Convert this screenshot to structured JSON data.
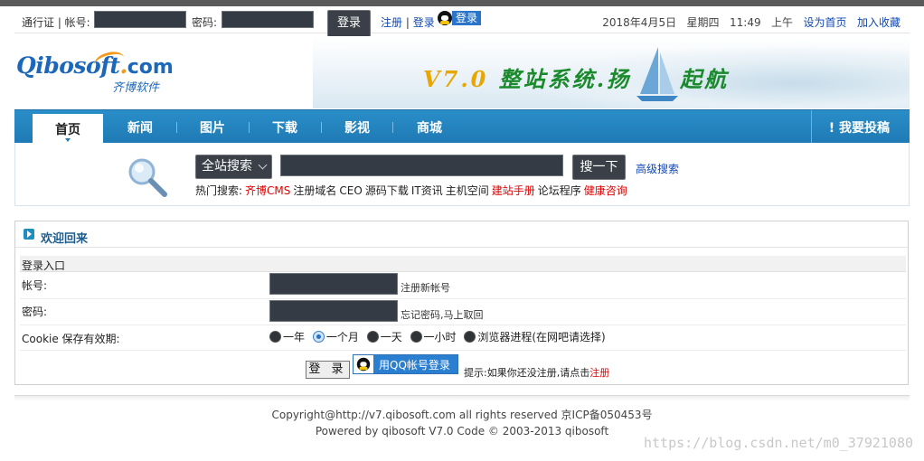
{
  "topbar": {
    "passport_label": "通行证 | 帐号:",
    "password_label": "密码:",
    "login_button": "登录",
    "register_link": "注册",
    "sep": "|",
    "login_link": "登录",
    "qq_login_label": "登录",
    "date": "2018年4月5日",
    "weekday": "星期四",
    "time": "11:49",
    "ampm": "上午",
    "set_homepage": "设为首页",
    "add_favorite": "加入收藏"
  },
  "banner": {
    "logo_main": "Qibosoft",
    "logo_dot": ".",
    "logo_com": "com",
    "logo_cn": "齐博软件",
    "slogan_version": "V7.0",
    "slogan_text1": "整站系统.扬",
    "slogan_text2": "起航"
  },
  "nav": {
    "items": [
      {
        "label": "首页",
        "active": true
      },
      {
        "label": "新闻"
      },
      {
        "label": "图片"
      },
      {
        "label": "下载"
      },
      {
        "label": "影视"
      },
      {
        "label": "商城"
      }
    ],
    "contribute": "我要投稿"
  },
  "search": {
    "scope": "全站搜索",
    "button": "搜一下",
    "advanced": "高级搜索",
    "hot_label": "热门搜索:",
    "hot": [
      {
        "text": "齐博CMS",
        "red": true
      },
      {
        "text": "注册域名"
      },
      {
        "text": "CEO"
      },
      {
        "text": "源码下载"
      },
      {
        "text": "IT资讯"
      },
      {
        "text": "主机空间"
      },
      {
        "text": "建站手册",
        "red": true
      },
      {
        "text": "论坛程序"
      },
      {
        "text": "健康咨询",
        "red": true
      }
    ]
  },
  "panel": {
    "title": "欢迎回来",
    "section": "登录入口",
    "account_label": "帐号:",
    "register_new": "注册新帐号",
    "password_label": "密码:",
    "forgot": "忘记密码,马上取回",
    "cookie_label": "Cookie 保存有效期:",
    "cookie_options": [
      {
        "label": "一年"
      },
      {
        "label": "一个月",
        "selected": true
      },
      {
        "label": "一天"
      },
      {
        "label": "一小时"
      },
      {
        "label": "浏览器进程(在网吧请选择)"
      }
    ],
    "login_button": "登 录",
    "qq_button": "用QQ帐号登录",
    "tip_prefix": "提示:如果你还没注册,请点击",
    "tip_link": "注册"
  },
  "footer": {
    "copyright": "Copyright@http://v7.qibosoft.com all rights reserved 京ICP备050453号",
    "powered": "Powered by qibosoft V7.0 Code © 2003-2013 qibosoft"
  },
  "watermark": "https://blog.csdn.net/m0_37921080"
}
